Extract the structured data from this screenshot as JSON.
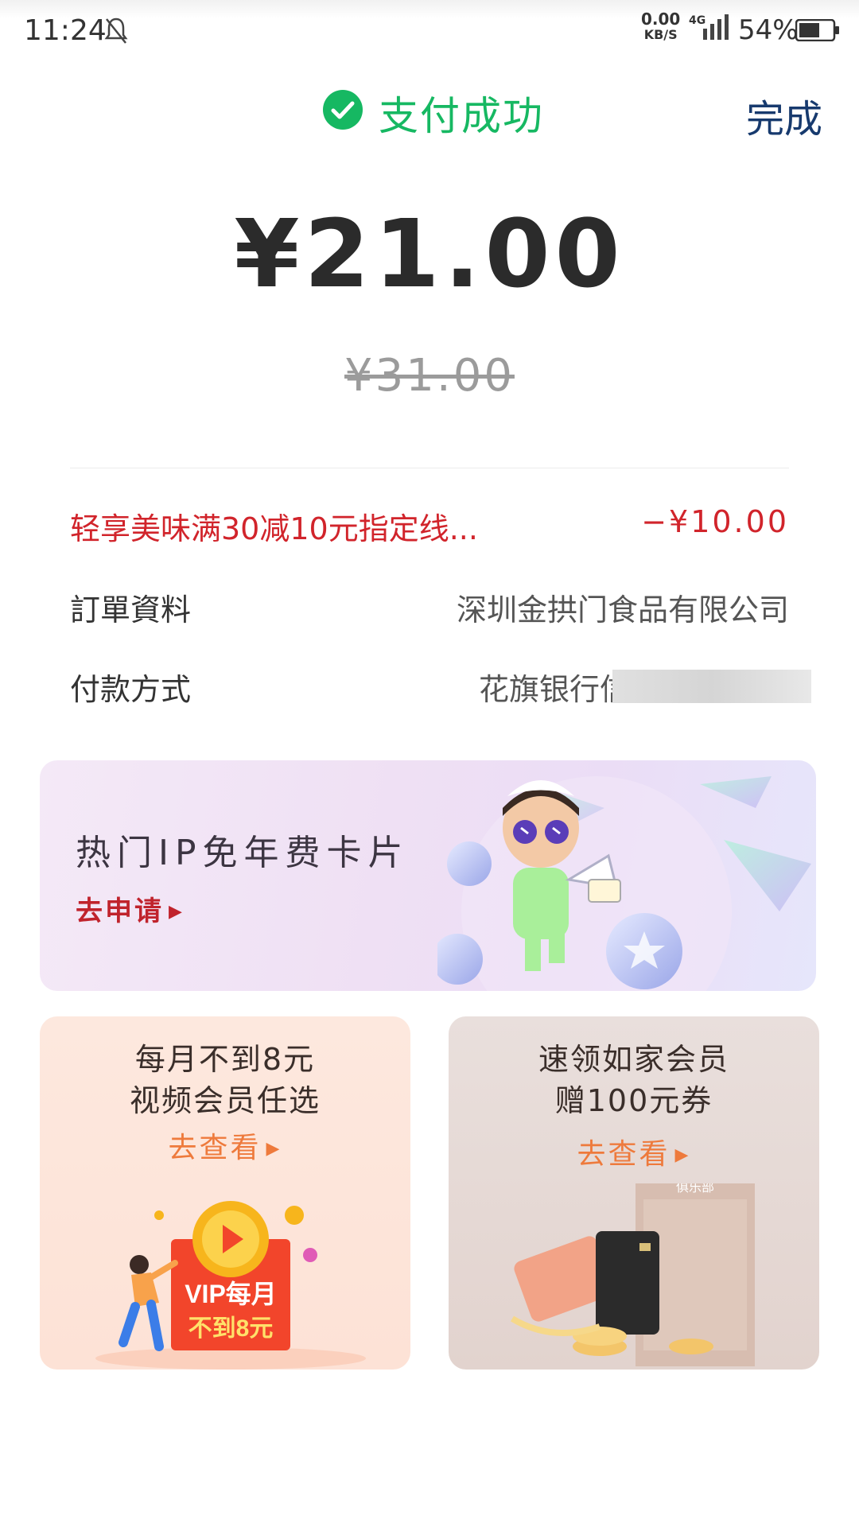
{
  "status_bar": {
    "time": "11:24",
    "net_speed": "0.00",
    "net_unit": "KB/S",
    "network": "4G",
    "battery": "54%"
  },
  "header": {
    "title": "支付成功",
    "done_label": "完成",
    "accent_color": "#16b862"
  },
  "payment": {
    "amount": "¥21.00",
    "original_amount": "¥31.00"
  },
  "details": {
    "discount_label": "轻享美味满30减10元指定线...",
    "discount_value": "−¥10.00",
    "order_label": "訂單資料",
    "order_value": "深圳金拱门食品有限公司",
    "payment_label": "付款方式",
    "payment_value": "花旗银行信"
  },
  "banner": {
    "title": "热门IP免年费卡片",
    "cta": "去申请"
  },
  "cards": {
    "left": {
      "line1": "每月不到8元",
      "line2": "视频会员任选",
      "cta": "去查看",
      "art_line1": "VIP每月",
      "art_line2": "不到8元"
    },
    "right": {
      "line1": "速领如家会员",
      "line2": "赠100元券",
      "cta": "去查看",
      "art_brand": "俱乐部"
    }
  }
}
